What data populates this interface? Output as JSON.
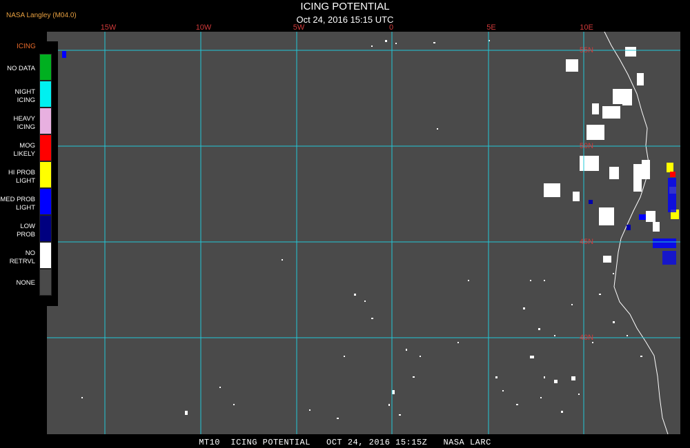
{
  "header": {
    "source": "NASA Langley (M04.0)",
    "title": "ICING POTENTIAL",
    "subtitle": "Oct 24, 2016 15:15 UTC"
  },
  "map": {
    "longitude_labels": [
      "15W",
      "10W",
      "5W",
      "0",
      "5E",
      "10E"
    ],
    "latitude_labels": [
      "55N",
      "50N",
      "45N",
      "40N"
    ],
    "background_color": "#4a4a4a",
    "grid_color": "#22c8d8",
    "label_color": "#d03a3a"
  },
  "legend": {
    "title": "ICING",
    "items": [
      {
        "label": "NO DATA",
        "color": "#00b020"
      },
      {
        "label": "NIGHT\nICING",
        "color": "#00f0f0"
      },
      {
        "label": "HEAVY\nICING",
        "color": "#e8b0e0"
      },
      {
        "label": "MOG\nLIKELY",
        "color": "#ff0000"
      },
      {
        "label": "HI PROB\nLIGHT",
        "color": "#ffff00"
      },
      {
        "label": "MED PROB\nLIGHT",
        "color": "#0000ff"
      },
      {
        "label": "LOW\nPROB",
        "color": "#000080"
      },
      {
        "label": "NO\nRETRVL",
        "color": "#ffffff"
      },
      {
        "label": "NONE",
        "color": "#4a4a4a"
      }
    ]
  },
  "footer": {
    "text": "MT10  ICING POTENTIAL   OCT 24, 2016 15:15Z   NASA LARC"
  }
}
